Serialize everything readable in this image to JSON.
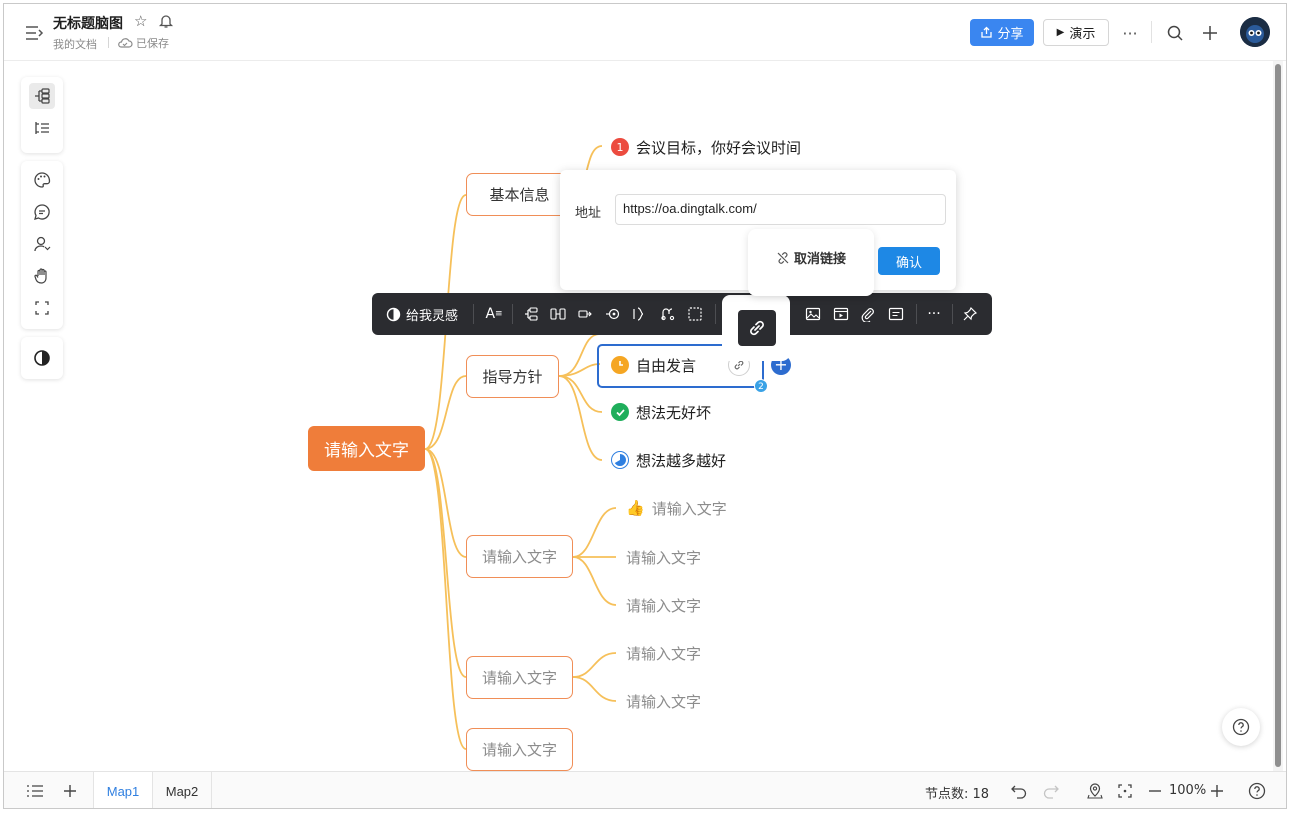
{
  "header": {
    "title": "无标题脑图",
    "breadcrumb": "我的文档",
    "saved_status": "已保存",
    "share_label": "分享",
    "present_label": "演示",
    "more_label": "···"
  },
  "mindmap": {
    "root": "请输入文字",
    "branches": [
      "基本信息",
      "指导方针",
      "请输入文字",
      "请输入文字",
      "请输入文字"
    ],
    "basic_info_child": "会议目标，你好会议时间",
    "guideline_children": [
      "自由发言",
      "想法无好坏",
      "想法越多越好"
    ],
    "branch3_children": [
      "请输入文字",
      "请输入文字",
      "请输入文字"
    ],
    "branch4_children": [
      "请输入文字",
      "请输入文字"
    ],
    "selected_child_count": "2",
    "badge_number": "1"
  },
  "link_popup": {
    "label": "地址",
    "url": "https://oa.dingtalk.com/",
    "unlink_label": "取消链接",
    "confirm_label": "确认"
  },
  "float_toolbar": {
    "inspire_label": "给我灵感",
    "more_label": "···"
  },
  "footer": {
    "tabs": [
      "Map1",
      "Map2"
    ],
    "node_count": "节点数: 18",
    "zoom": "100%"
  },
  "colors": {
    "accent": "#3a86f0",
    "root": "#ef7d3a",
    "branch_border": "#f08e57",
    "line": "#f6c05a",
    "selected": "#2d6ccf",
    "toolbar": "#2b2c30"
  }
}
